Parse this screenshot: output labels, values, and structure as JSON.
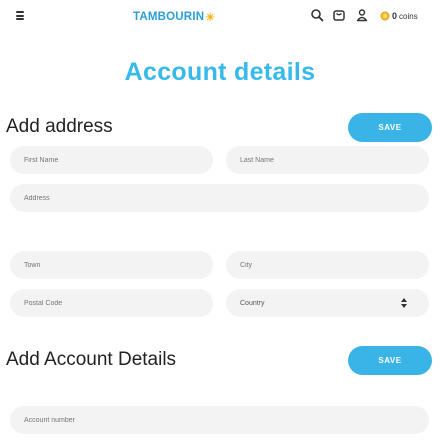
{
  "header": {
    "logo_text": "TAMBOURIN",
    "logo_sun_glyph": "☀",
    "icons": [
      "menu-icon",
      "search-icon",
      "cart-icon",
      "user-icon",
      "coin-icon"
    ],
    "coins_count": "0",
    "coins_label": "coins",
    "accent_color": "#37b9ea",
    "logo_color": "#2a9fd6",
    "sun_color": "#f6b417"
  },
  "page": {
    "title": "Account details"
  },
  "address_section": {
    "title": "Add address",
    "save_label": "SAVE",
    "first_name_placeholder": "First Name",
    "last_name_placeholder": "Last Name",
    "address_placeholder": "Address",
    "town_placeholder": "Town",
    "city_placeholder": "City",
    "postal_code_placeholder": "Postal Code",
    "country_selected": "Country"
  },
  "account_section": {
    "title": "Add Account Details",
    "save_label": "SAVE",
    "account_number_placeholder": "Account number"
  }
}
